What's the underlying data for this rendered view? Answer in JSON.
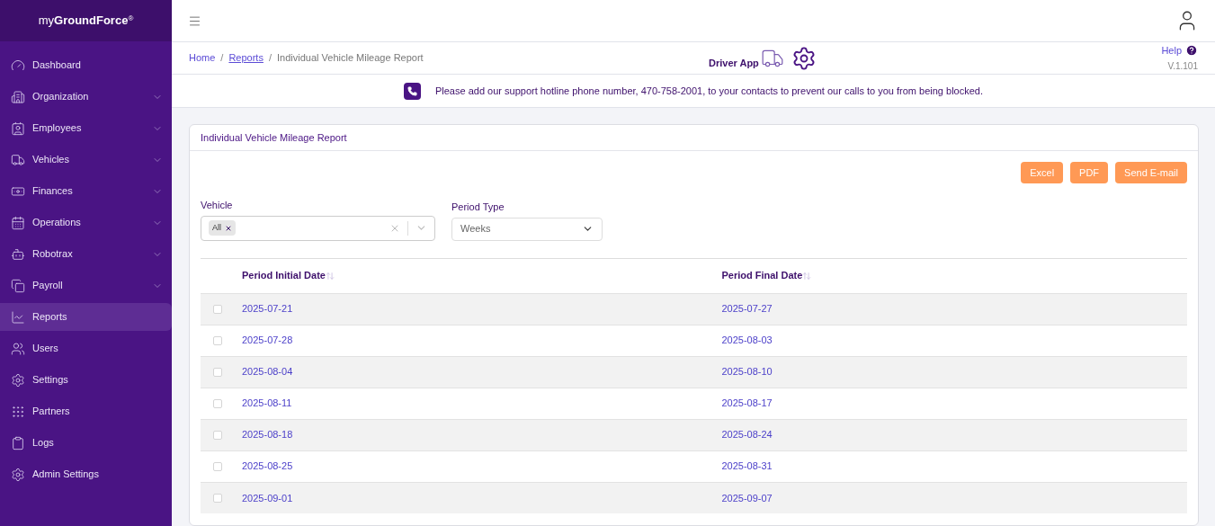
{
  "logo": "my**GroundForce**$^{®}$",
  "sidebar": {
    "items": [
      {
        "label": "Dashboard",
        "expandable": false,
        "selected": false
      },
      {
        "label": "Organization",
        "expandable": true,
        "selected": false
      },
      {
        "label": "Employees",
        "expandable": true,
        "selected": false
      },
      {
        "label": "Vehicles",
        "expandable": true,
        "selected": false
      },
      {
        "label": "Finances",
        "expandable": true,
        "selected": false
      },
      {
        "label": "Operations",
        "expandable": true,
        "selected": false
      },
      {
        "label": "Robotrax",
        "expandable": true,
        "selected": false
      },
      {
        "label": "Payroll",
        "expandable": true,
        "selected": false
      },
      {
        "label": "Reports",
        "expandable": false,
        "selected": true
      },
      {
        "label": "Users",
        "expandable": false,
        "selected": false
      },
      {
        "label": "Settings",
        "expandable": false,
        "selected": false
      },
      {
        "label": "Partners",
        "expandable": false,
        "selected": false
      },
      {
        "label": "Logs",
        "expandable": false,
        "selected": false
      },
      {
        "label": "Admin Settings",
        "expandable": false,
        "selected": false
      }
    ]
  },
  "breadcrumb": [
    "Home",
    "Reports",
    "Individual Vehicle Mileage Report"
  ],
  "breadcrumb_separators": [
    "/",
    "/"
  ],
  "driver_app": "Driver App",
  "help": "Help",
  "version": "V.1.101",
  "notice": "Please add our support hotline phone number, 470-758-2001, to your contacts to prevent our calls to you from being blocked.",
  "card": {
    "title": "Individual Vehicle Mileage Report",
    "buttons": [
      "Excel",
      "PDF",
      "Send E-mail"
    ],
    "vehicle": {
      "label": "Vehicle",
      "chips": [
        "All"
      ]
    },
    "period_type": {
      "label": "Period Type",
      "value": "Weeks"
    },
    "table": {
      "columns": [
        "Period Initial Date",
        "Period Final Date"
      ],
      "rows": [
        {
          "checked": false,
          "cells": [
            "2025-07-21",
            "2025-07-27"
          ]
        },
        {
          "checked": false,
          "cells": [
            "2025-07-28",
            "2025-08-03"
          ]
        },
        {
          "checked": false,
          "cells": [
            "2025-08-04",
            "2025-08-10"
          ]
        },
        {
          "checked": false,
          "cells": [
            "2025-08-11",
            "2025-08-17"
          ]
        },
        {
          "checked": false,
          "cells": [
            "2025-08-18",
            "2025-08-24"
          ]
        },
        {
          "checked": false,
          "cells": [
            "2025-08-25",
            "2025-08-31"
          ]
        },
        {
          "checked": false,
          "cells": [
            "2025-09-01",
            "2025-09-07"
          ]
        }
      ]
    }
  }
}
